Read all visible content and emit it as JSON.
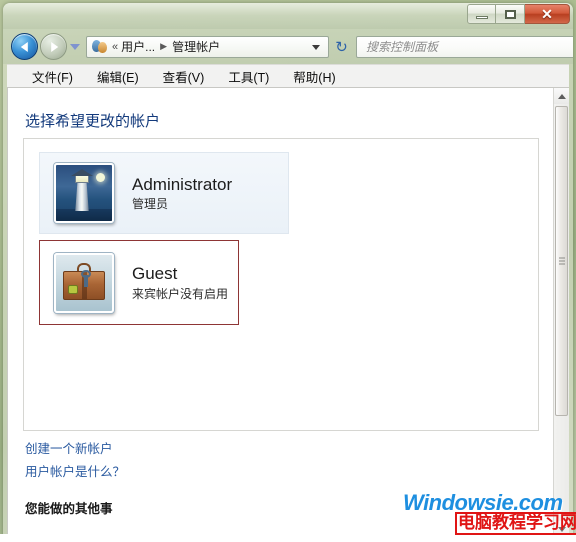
{
  "window": {
    "title": "",
    "controls": {
      "minimize": "–",
      "maximize": "□",
      "close": "✕"
    }
  },
  "nav": {
    "back_tooltip": "后退",
    "forward_tooltip": "前进",
    "breadcrumb": {
      "icon": "user-accounts-icon",
      "overflow": "«",
      "items": [
        "用户...",
        "管理帐户"
      ],
      "separator": "▶"
    },
    "refresh_glyph": "↻",
    "search": {
      "placeholder": "搜索控制面板",
      "value": ""
    }
  },
  "menubar": {
    "items": [
      "文件(F)",
      "编辑(E)",
      "查看(V)",
      "工具(T)",
      "帮助(H)"
    ]
  },
  "main": {
    "page_title": "选择希望更改的帐户",
    "accounts": [
      {
        "name": "Administrator",
        "description": "管理员",
        "avatar": "lighthouse-avatar",
        "selected": false,
        "highlight_color": "#dfe7ef"
      },
      {
        "name": "Guest",
        "description": "来宾帐户没有启用",
        "avatar": "suitcase-avatar",
        "selected": true,
        "highlight_color": "#8e3535"
      }
    ],
    "links": [
      "创建一个新帐户",
      "用户帐户是什么？"
    ],
    "other_heading": "您能做的其他事"
  },
  "scrollbar": {
    "up_glyph": "▲",
    "down_glyph": "▼"
  },
  "watermark": {
    "site": "Windowsie.com",
    "tagline": "电脑教程学习网"
  },
  "colors": {
    "accent_blue": "#2a5aa0",
    "title_blue": "#133a7c",
    "selection_red": "#8e3535",
    "close_red": "#c9502f",
    "watermark_blue": "#1e8fe0",
    "watermark_red": "#e01515"
  }
}
